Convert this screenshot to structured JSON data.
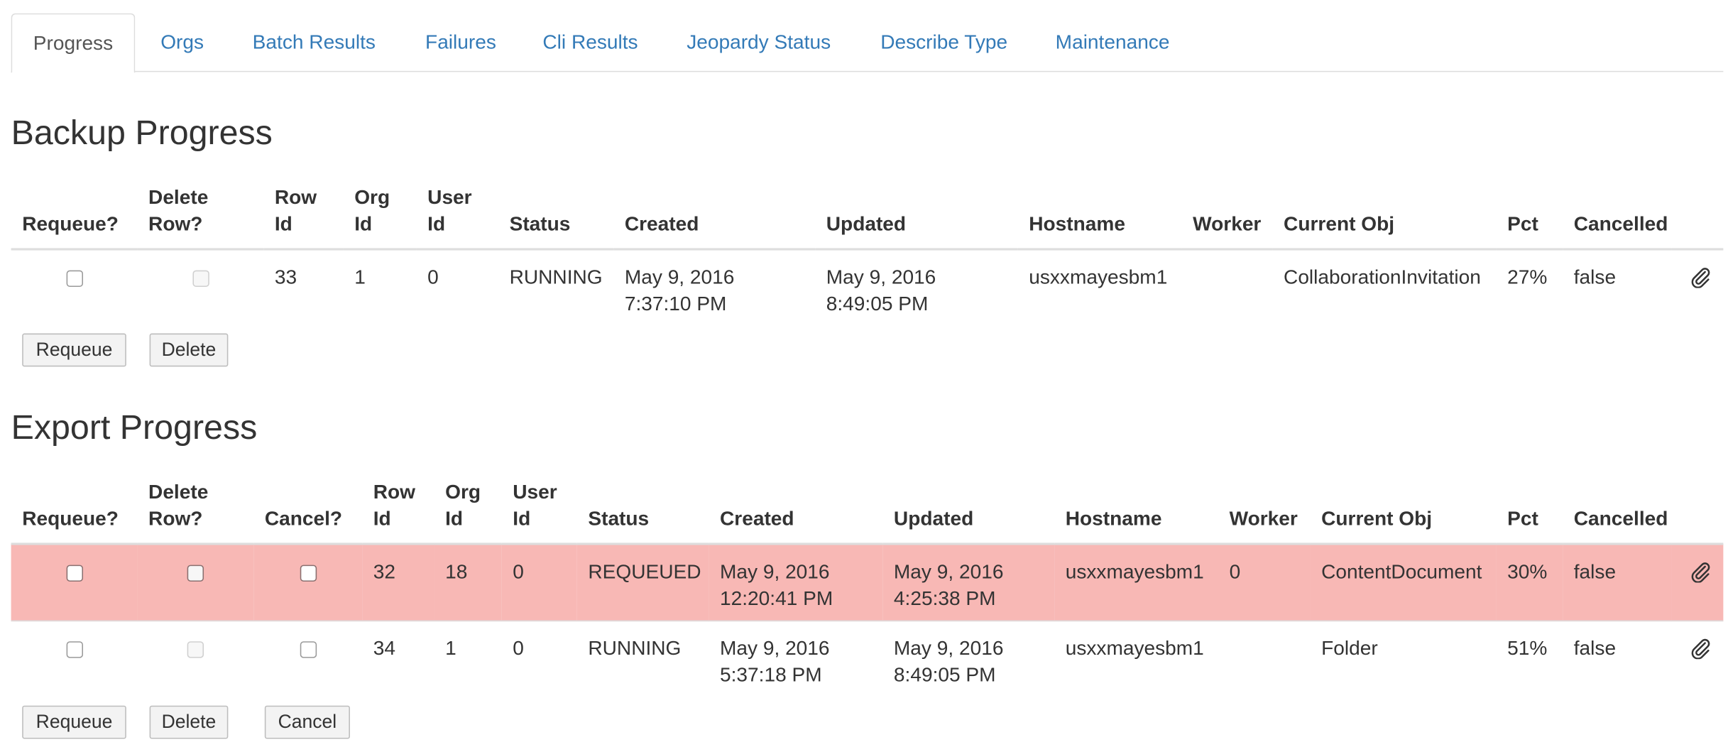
{
  "tabs": [
    {
      "label": "Progress",
      "active": true
    },
    {
      "label": "Orgs"
    },
    {
      "label": "Batch Results"
    },
    {
      "label": "Failures"
    },
    {
      "label": "Cli Results"
    },
    {
      "label": "Jeopardy Status"
    },
    {
      "label": "Describe Type"
    },
    {
      "label": "Maintenance"
    }
  ],
  "backup": {
    "title": "Backup Progress",
    "headers": [
      "Requeue?",
      "Delete Row?",
      "Row Id",
      "Org Id",
      "User Id",
      "Status",
      "Created",
      "Updated",
      "Hostname",
      "Worker",
      "Current Obj",
      "Pct",
      "Cancelled"
    ],
    "rows": [
      {
        "row_id": "33",
        "org_id": "1",
        "user_id": "0",
        "status": "RUNNING",
        "created_date": "May 9, 2016",
        "created_time": "7:37:10 PM",
        "updated_date": "May 9, 2016",
        "updated_time": "8:49:05 PM",
        "hostname": "usxxmayesbm1",
        "worker": "",
        "current_obj": "CollaborationInvitation",
        "pct": "27%",
        "cancelled": "false",
        "icon": "paperclip-icon"
      }
    ],
    "buttons": {
      "requeue": "Requeue",
      "delete": "Delete"
    }
  },
  "export": {
    "title": "Export Progress",
    "headers": [
      "Requeue?",
      "Delete Row?",
      "Cancel?",
      "Row Id",
      "Org Id",
      "User Id",
      "Status",
      "Created",
      "Updated",
      "Hostname",
      "Worker",
      "Current Obj",
      "Pct",
      "Cancelled"
    ],
    "rows": [
      {
        "row_id": "32",
        "org_id": "18",
        "user_id": "0",
        "status": "REQUEUED",
        "created_date": "May 9, 2016",
        "created_time": "12:20:41 PM",
        "updated_date": "May 9, 2016",
        "updated_time": "4:25:38 PM",
        "hostname": "usxxmayesbm1",
        "worker": "0",
        "current_obj": "ContentDocument",
        "pct": "30%",
        "cancelled": "false",
        "highlight_color": "#f8b8b5",
        "icon": "paperclip-icon"
      },
      {
        "row_id": "34",
        "org_id": "1",
        "user_id": "0",
        "status": "RUNNING",
        "created_date": "May 9, 2016",
        "created_time": "5:37:18 PM",
        "updated_date": "May 9, 2016",
        "updated_time": "8:49:05 PM",
        "hostname": "usxxmayesbm1",
        "worker": "",
        "current_obj": "Folder",
        "pct": "51%",
        "cancelled": "false",
        "icon": "paperclip-icon"
      }
    ],
    "buttons": {
      "requeue": "Requeue",
      "delete": "Delete",
      "cancel": "Cancel"
    }
  },
  "colors": {
    "link": "#337ab7",
    "warning_row": "#f8b8b5",
    "border": "#dddddd"
  }
}
